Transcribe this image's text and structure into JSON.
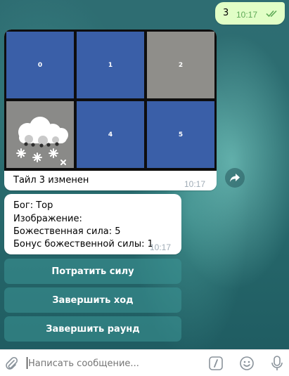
{
  "outgoing": {
    "text": "3",
    "time": "10:17"
  },
  "board": {
    "tiles": [
      {
        "label": "0",
        "state": "blue"
      },
      {
        "label": "1",
        "state": "blue"
      },
      {
        "label": "2",
        "state": "gray"
      },
      {
        "label": "",
        "state": "image",
        "icon": "snow-cloud-icon"
      },
      {
        "label": "4",
        "state": "blue"
      },
      {
        "label": "5",
        "state": "blue"
      }
    ],
    "caption": "Тайл 3 изменен",
    "time": "10:17"
  },
  "info": {
    "god": "Бог: Тор",
    "image": "Изображение:",
    "power": "Божественная сила: 5",
    "bonus": "Бонус божественной силы: 1",
    "time": "10:17"
  },
  "keyboard": {
    "spend": "Потратить силу",
    "end_turn": "Завершить ход",
    "end_round": "Завершить раунд"
  },
  "composer": {
    "placeholder": "Написать сообщение..."
  },
  "colors": {
    "tile_blue": "#3a5fa8",
    "tile_gray": "#8f8e8a",
    "outgoing_bg": "#e1fec6"
  }
}
